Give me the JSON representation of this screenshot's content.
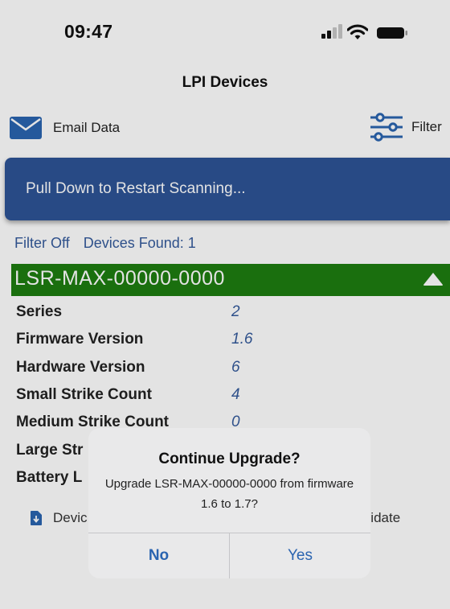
{
  "status_bar": {
    "time": "09:47"
  },
  "nav": {
    "title": "LPI Devices"
  },
  "toolbar": {
    "email_label": "Email Data",
    "filter_label": "Filter"
  },
  "banner": {
    "text": "Pull Down to Restart Scanning..."
  },
  "scan": {
    "filter_status": "Filter Off",
    "devices_found": "Devices Found: 1"
  },
  "device": {
    "name": "LSR-MAX-00000-0000",
    "details": [
      {
        "label": "Series",
        "value": "2"
      },
      {
        "label": "Firmware Version",
        "value": "1.6"
      },
      {
        "label": "Hardware Version",
        "value": "6"
      },
      {
        "label": "Small Strike Count",
        "value": "4"
      },
      {
        "label": "Medium Strike Count",
        "value": "0"
      },
      {
        "label": "Large Str",
        "value": ""
      },
      {
        "label": "Battery L",
        "value": ""
      }
    ],
    "footer_left": "Devic",
    "footer_right": "Validate"
  },
  "alert": {
    "title": "Continue Upgrade?",
    "message": "Upgrade LSR-MAX-00000-0000 from firmware 1.6 to 1.7?",
    "no_label": "No",
    "yes_label": "Yes"
  },
  "colors": {
    "banner": "#2e5496",
    "device_header": "#1e7d10",
    "link_blue": "#345a9c",
    "alert_button": "#2a64b0"
  },
  "icons": {
    "email": "envelope-icon",
    "filter": "sliders-icon",
    "collapse": "triangle-up-icon",
    "download": "file-download-icon"
  }
}
